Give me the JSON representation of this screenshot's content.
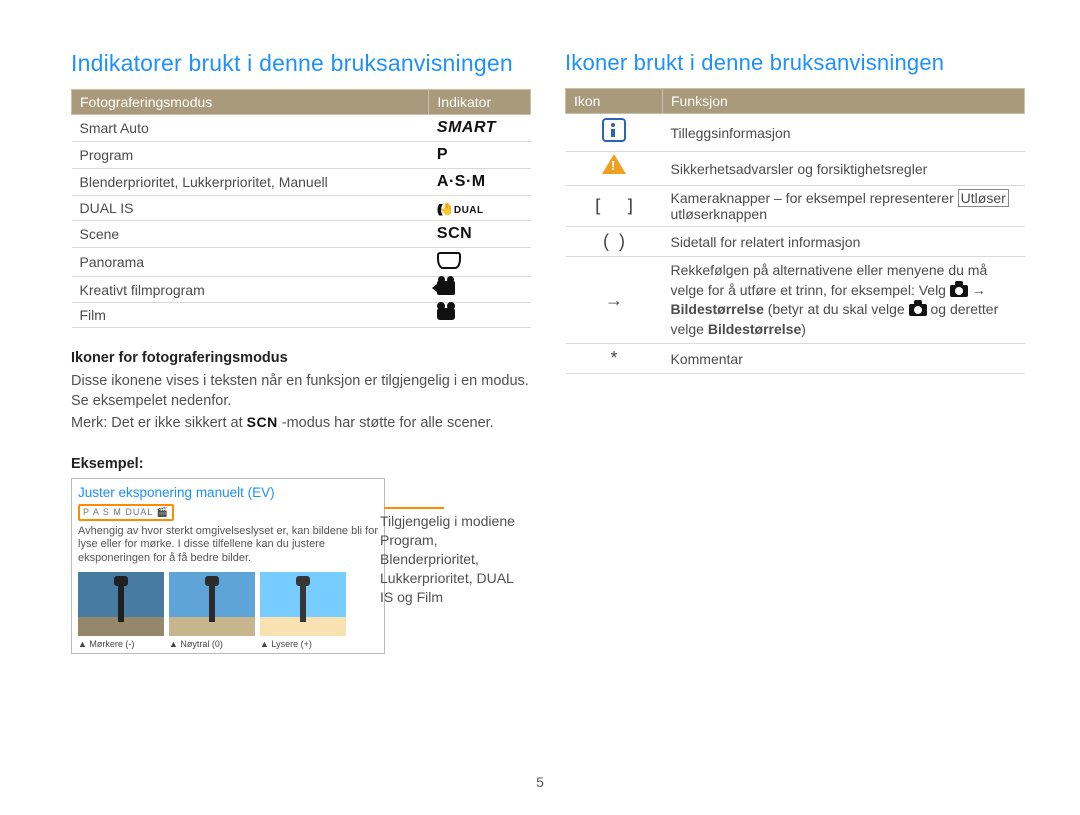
{
  "page_number": "5",
  "left": {
    "heading": "Indikatorer brukt i denne bruksanvisningen",
    "table_headers": [
      "Fotograferingsmodus",
      "Indikator"
    ],
    "rows": [
      {
        "mode": "Smart Auto",
        "indicator": "SMART",
        "icon": "text-smart"
      },
      {
        "mode": "Program",
        "indicator": "P",
        "icon": "text-p"
      },
      {
        "mode": "Blenderprioritet, Lukkerprioritet, Manuell",
        "indicator": "A·S·M",
        "icon": "text-asm"
      },
      {
        "mode": "DUAL IS",
        "indicator": "DUAL",
        "icon": "dual"
      },
      {
        "mode": "Scene",
        "indicator": "SCN",
        "icon": "text-scn"
      },
      {
        "mode": "Panorama",
        "indicator": "",
        "icon": "pano"
      },
      {
        "mode": "Kreativt filmprogram",
        "indicator": "",
        "icon": "movie"
      },
      {
        "mode": "Film",
        "indicator": "",
        "icon": "film"
      }
    ],
    "sub1": "Ikoner for fotograferingsmodus",
    "body1": "Disse ikonene vises i teksten når en funksjon er tilgjengelig i en modus. Se eksempelet nedenfor.",
    "body2_pre": "Merk: Det er ikke sikkert at ",
    "body2_scn": "SCN",
    "body2_post": "-modus har støtte for alle scener.",
    "example_label": "Eksempel:",
    "example": {
      "title": "Juster eksponering manuelt (EV)",
      "modes": "P A S M DUAL 🎬",
      "text": "Avhengig av hvor sterkt omgivelseslyset er, kan bildene bli for lyse eller for mørke. I disse tilfellene kan du justere eksponeringen for å få bedre bilder.",
      "captions": [
        "▲ Mørkere (-)",
        "▲ Nøytral (0)",
        "▲ Lysere (+)"
      ]
    },
    "callout": "Tilgjengelig i modiene Program, Blenderprioritet, Lukkerprioritet, DUAL IS og Film"
  },
  "right": {
    "heading": "Ikoner brukt i denne bruksanvisningen",
    "table_headers": [
      "Ikon",
      "Funksjon"
    ],
    "rows": [
      {
        "icon": "info",
        "text": "Tilleggsinformasjon"
      },
      {
        "icon": "warn",
        "text": "Sikkerhetsadvarsler og forsiktighetsregler"
      },
      {
        "icon": "brackets",
        "text_pre": "Kameraknapper – for eksempel representerer ",
        "boxed": "Utløser",
        "text_post": " utløserknappen"
      },
      {
        "icon": "paren",
        "text": "Sidetall for relatert informasjon"
      },
      {
        "icon": "arrow",
        "text_pre": "Rekkefølgen på alternativene eller menyene du må velge for å utføre et trinn, for eksempel: Velg ",
        "cam1": true,
        "arrow1": " → ",
        "bold1": "Bildestørrelse",
        "text_mid": " (betyr at du skal velge ",
        "cam2": true,
        "text_mid2": " og deretter velge ",
        "bold2": "Bildestørrelse",
        "text_post": ")"
      },
      {
        "icon": "star",
        "text": "Kommentar"
      }
    ]
  }
}
